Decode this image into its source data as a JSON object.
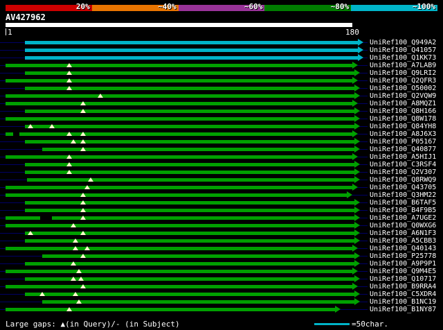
{
  "key": {
    "segments": [
      {
        "label": "20%",
        "color": "#cc0000"
      },
      {
        "label": "~40%",
        "color": "#e87400"
      },
      {
        "label": "~60%",
        "color": "#993399"
      },
      {
        "label": "~80%",
        "color": "#007d00"
      },
      {
        "label": "~100%",
        "color": "#00b4c8"
      }
    ]
  },
  "query": {
    "id": "AV427962",
    "scale_start": "1",
    "scale_end": "180"
  },
  "chart_data": {
    "type": "bar",
    "orientation": "horizontal-span",
    "title": "AV427962",
    "x_range": [
      1,
      180
    ],
    "colors": {
      "cyan": "#00b4c8",
      "green": "#00a000"
    },
    "rows": [
      {
        "label": "UniRef100_Q949A2",
        "color": "cyan",
        "span": [
          11,
          183
        ],
        "query_gaps": [],
        "subject_gaps": []
      },
      {
        "label": "UniRef100_Q41057",
        "color": "cyan",
        "span": [
          11,
          183
        ],
        "query_gaps": [],
        "subject_gaps": []
      },
      {
        "label": "UniRef100_Q1KK73",
        "color": "cyan",
        "span": [
          11,
          183
        ],
        "query_gaps": [],
        "subject_gaps": []
      },
      {
        "label": "UniRef100_A7LAB9",
        "color": "green",
        "span": [
          1,
          180
        ],
        "query_gaps": [
          34
        ],
        "subject_gaps": []
      },
      {
        "label": "UniRef100_Q9LRI2",
        "color": "green",
        "span": [
          11,
          181
        ],
        "query_gaps": [
          34
        ],
        "subject_gaps": []
      },
      {
        "label": "UniRef100_Q2QFR3",
        "color": "green",
        "span": [
          1,
          180
        ],
        "query_gaps": [
          34
        ],
        "subject_gaps": []
      },
      {
        "label": "UniRef100_O50002",
        "color": "green",
        "span": [
          11,
          181
        ],
        "query_gaps": [
          34
        ],
        "subject_gaps": []
      },
      {
        "label": "UniRef100_Q2VQW9",
        "color": "green",
        "span": [
          1,
          181
        ],
        "query_gaps": [
          50
        ],
        "subject_gaps": []
      },
      {
        "label": "UniRef100_A8MQZ1",
        "color": "green",
        "span": [
          1,
          180
        ],
        "query_gaps": [
          41
        ],
        "subject_gaps": []
      },
      {
        "label": "UniRef100_Q8H166",
        "color": "green",
        "span": [
          11,
          181
        ],
        "query_gaps": [
          41
        ],
        "subject_gaps": []
      },
      {
        "label": "UniRef100_Q8W178",
        "color": "green",
        "span": [
          1,
          181
        ],
        "query_gaps": [],
        "subject_gaps": []
      },
      {
        "label": "UniRef100_Q84YH8",
        "color": "green",
        "span": [
          11,
          181
        ],
        "query_gaps": [
          14,
          25
        ],
        "subject_gaps": []
      },
      {
        "label": "UniRef100_A8J6X3",
        "color": "green",
        "span": [
          1,
          180
        ],
        "query_gaps": [
          34,
          41
        ],
        "subject_gaps": [
          [
            5,
            8
          ]
        ]
      },
      {
        "label": "UniRef100_P05167",
        "color": "green",
        "span": [
          11,
          181
        ],
        "query_gaps": [
          36,
          41
        ],
        "subject_gaps": []
      },
      {
        "label": "UniRef100_Q40877",
        "color": "green",
        "span": [
          20,
          181
        ],
        "query_gaps": [
          41
        ],
        "subject_gaps": []
      },
      {
        "label": "UniRef100_A5HIJ1",
        "color": "green",
        "span": [
          1,
          180
        ],
        "query_gaps": [
          34
        ],
        "subject_gaps": []
      },
      {
        "label": "UniRef100_C3RSF4",
        "color": "green",
        "span": [
          11,
          181
        ],
        "query_gaps": [
          34
        ],
        "subject_gaps": []
      },
      {
        "label": "UniRef100_Q2V307",
        "color": "green",
        "span": [
          11,
          181
        ],
        "query_gaps": [
          34
        ],
        "subject_gaps": []
      },
      {
        "label": "UniRef100_Q8RWQ9",
        "color": "green",
        "span": [
          12,
          181
        ],
        "query_gaps": [
          45
        ],
        "subject_gaps": []
      },
      {
        "label": "UniRef100_Q43705",
        "color": "green",
        "span": [
          1,
          180
        ],
        "query_gaps": [
          43
        ],
        "subject_gaps": []
      },
      {
        "label": "UniRef100_Q3HM22",
        "color": "green",
        "span": [
          1,
          177
        ],
        "query_gaps": [
          41
        ],
        "subject_gaps": []
      },
      {
        "label": "UniRef100_B6TAF5",
        "color": "green",
        "span": [
          11,
          181
        ],
        "query_gaps": [
          41
        ],
        "subject_gaps": []
      },
      {
        "label": "UniRef100_B4F9B5",
        "color": "green",
        "span": [
          11,
          181
        ],
        "query_gaps": [
          41
        ],
        "subject_gaps": []
      },
      {
        "label": "UniRef100_A7UGE2",
        "color": "green",
        "span": [
          1,
          181
        ],
        "query_gaps": [
          41
        ],
        "subject_gaps": [
          [
            19,
            25
          ]
        ]
      },
      {
        "label": "UniRef100_Q0WXG6",
        "color": "green",
        "span": [
          1,
          181
        ],
        "query_gaps": [
          36
        ],
        "subject_gaps": []
      },
      {
        "label": "UniRef100_A6N1F3",
        "color": "green",
        "span": [
          11,
          181
        ],
        "query_gaps": [
          14,
          41
        ],
        "subject_gaps": []
      },
      {
        "label": "UniRef100_A5CBB3",
        "color": "green",
        "span": [
          11,
          181
        ],
        "query_gaps": [
          37
        ],
        "subject_gaps": []
      },
      {
        "label": "UniRef100_Q40143",
        "color": "green",
        "span": [
          1,
          180
        ],
        "query_gaps": [
          37,
          43
        ],
        "subject_gaps": []
      },
      {
        "label": "UniRef100_P25778",
        "color": "green",
        "span": [
          20,
          181
        ],
        "query_gaps": [
          41
        ],
        "subject_gaps": []
      },
      {
        "label": "UniRef100_A9P9P1",
        "color": "green",
        "span": [
          11,
          181
        ],
        "query_gaps": [
          36
        ],
        "subject_gaps": []
      },
      {
        "label": "UniRef100_Q9M4E5",
        "color": "green",
        "span": [
          1,
          180
        ],
        "query_gaps": [
          39
        ],
        "subject_gaps": []
      },
      {
        "label": "UniRef100_Q10717",
        "color": "green",
        "span": [
          11,
          181
        ],
        "query_gaps": [
          36,
          40
        ],
        "subject_gaps": []
      },
      {
        "label": "UniRef100_B9RRA4",
        "color": "green",
        "span": [
          1,
          180
        ],
        "query_gaps": [
          41
        ],
        "subject_gaps": []
      },
      {
        "label": "UniRef100_C5XDR4",
        "color": "green",
        "span": [
          11,
          181
        ],
        "query_gaps": [
          20,
          37
        ],
        "subject_gaps": []
      },
      {
        "label": "UniRef100_B1NC19",
        "color": "green",
        "span": [
          20,
          181
        ],
        "query_gaps": [
          39
        ],
        "subject_gaps": []
      },
      {
        "label": "UniRef100_B1NY87",
        "color": "green",
        "span": [
          1,
          171
        ],
        "query_gaps": [
          34
        ],
        "subject_gaps": []
      }
    ]
  },
  "footer": {
    "gaps_legend": "Large gaps: ▲(in Query)/- (in Subject)",
    "scale_equals": "=50char.",
    "scale_line_color": "#00b4c8"
  }
}
